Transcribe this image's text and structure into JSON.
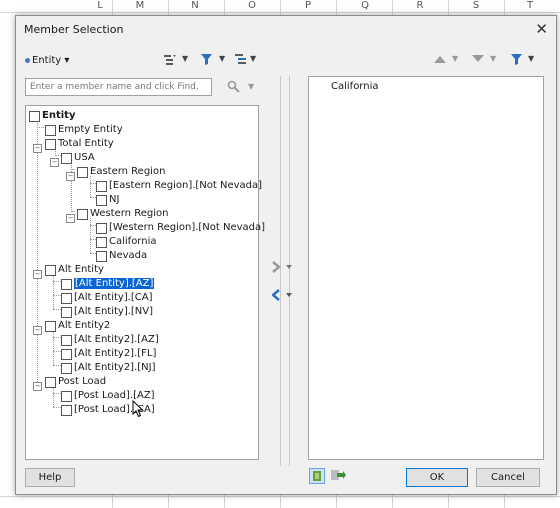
{
  "sheet": {
    "columns": [
      "L",
      "M",
      "N",
      "O",
      "P",
      "Q",
      "R",
      "S",
      "T"
    ]
  },
  "dialog": {
    "title": "Member Selection",
    "dimension_label": "Entity",
    "search_placeholder": "Enter a member name and click Find.",
    "tree": {
      "root": "Entity",
      "items": {
        "empty_entity": "Empty Entity",
        "total_entity": "Total Entity",
        "usa": "USA",
        "eastern_region": "Eastern Region",
        "eastern_not_nevada": "[Eastern Region].[Not Nevada]",
        "nj": "NJ",
        "western_region": "Western Region",
        "western_not_nevada": "[Western Region].[Not Nevada]",
        "california": "California",
        "nevada": "Nevada",
        "alt_entity": "Alt Entity",
        "alt_az": "[Alt Entity].[AZ]",
        "alt_ca": "[Alt Entity].[CA]",
        "alt_nv": "[Alt Entity].[NV]",
        "alt_entity2": "Alt Entity2",
        "alt2_az": "[Alt Entity2].[AZ]",
        "alt2_fl": "[Alt Entity2].[FL]",
        "alt2_nj": "[Alt Entity2].[NJ]",
        "post_load": "Post Load",
        "post_az": "[Post Load].[AZ]",
        "post_ca": "[Post Load].[CA]"
      }
    },
    "selection": [
      "California"
    ],
    "buttons": {
      "help": "Help",
      "ok": "OK",
      "cancel": "Cancel"
    }
  }
}
